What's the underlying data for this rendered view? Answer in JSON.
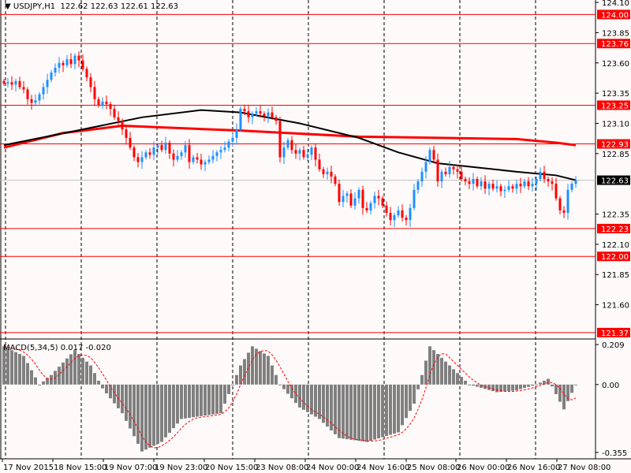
{
  "header": {
    "symbol": "USDJPY,H1",
    "ohlc": "122.62 122.63 122.61 122.63"
  },
  "colors": {
    "bull": "#1e90ff",
    "bear": "#ff0000",
    "level": "#ff0000",
    "ma_fast": "#ff0000",
    "ma_slow": "#000000",
    "hist": "#808080",
    "signal": "#ff0000",
    "bg": "#fffafa"
  },
  "chart_data": {
    "type": "candlestick",
    "title": "USDJPY,H1",
    "ylim": [
      121.33,
      124.12
    ],
    "price_ticks": [
      "124.10",
      "123.85",
      "123.60",
      "123.35",
      "123.10",
      "122.85",
      "122.35",
      "122.10",
      "121.85",
      "121.60"
    ],
    "levels": [
      "124.00",
      "123.76",
      "123.25",
      "122.93",
      "122.23",
      "122.00",
      "121.37"
    ],
    "current_price": "122.63",
    "x_labels": [
      "17 Nov 2015",
      "18 Nov 15:00",
      "19 Nov 07:00",
      "19 Nov 23:00",
      "20 Nov 15:00",
      "23 Nov 08:00",
      "24 Nov 00:00",
      "24 Nov 16:00",
      "25 Nov 08:00",
      "26 Nov 00:00",
      "26 Nov 16:00",
      "27 Nov 08:00"
    ],
    "closes": [
      123.43,
      123.44,
      123.42,
      123.45,
      123.4,
      123.38,
      123.3,
      123.27,
      123.29,
      123.34,
      123.4,
      123.46,
      123.52,
      123.56,
      123.6,
      123.58,
      123.63,
      123.59,
      123.66,
      123.62,
      123.55,
      123.48,
      123.4,
      123.3,
      123.25,
      123.28,
      123.26,
      123.22,
      123.15,
      123.12,
      123.05,
      122.98,
      122.9,
      122.82,
      122.78,
      122.82,
      122.86,
      122.84,
      122.9,
      122.92,
      122.88,
      122.94,
      122.85,
      122.8,
      122.83,
      122.86,
      122.92,
      122.78,
      122.82,
      122.8,
      122.76,
      122.78,
      122.8,
      122.83,
      122.86,
      122.88,
      122.9,
      122.95,
      122.98,
      123.05,
      123.22,
      123.2,
      123.15,
      123.18,
      123.2,
      123.18,
      123.16,
      123.19,
      123.15,
      123.12,
      122.82,
      122.9,
      122.96,
      122.88,
      122.85,
      122.88,
      122.82,
      122.84,
      122.9,
      122.8,
      122.72,
      122.68,
      122.7,
      122.66,
      122.6,
      122.45,
      122.5,
      122.52,
      122.42,
      122.48,
      122.55,
      122.4,
      122.38,
      122.44,
      122.5,
      122.48,
      122.42,
      122.36,
      122.3,
      122.34,
      122.38,
      122.32,
      122.3,
      122.4,
      122.55,
      122.62,
      122.7,
      122.78,
      122.88,
      122.8,
      122.62,
      122.7,
      122.68,
      122.74,
      122.72,
      122.7,
      122.64,
      122.62,
      122.6,
      122.64,
      122.58,
      122.62,
      122.56,
      122.6,
      122.56,
      122.58,
      122.54,
      122.55,
      122.58,
      122.56,
      122.6,
      122.58,
      122.62,
      122.58,
      122.6,
      122.64,
      122.7,
      122.64,
      122.62,
      122.6,
      122.48,
      122.38,
      122.36,
      122.55,
      122.6,
      122.63
    ],
    "ma_fast": [
      [
        0,
        122.9
      ],
      [
        15,
        123.02
      ],
      [
        30,
        123.08
      ],
      [
        60,
        123.04
      ],
      [
        90,
        122.99
      ],
      [
        130,
        122.97
      ],
      [
        140,
        122.94
      ],
      [
        145,
        122.92
      ]
    ],
    "ma_slow": [
      [
        0,
        122.92
      ],
      [
        20,
        123.05
      ],
      [
        35,
        123.15
      ],
      [
        50,
        123.21
      ],
      [
        60,
        123.19
      ],
      [
        75,
        123.1
      ],
      [
        90,
        122.98
      ],
      [
        100,
        122.86
      ],
      [
        110,
        122.77
      ],
      [
        130,
        122.7
      ],
      [
        140,
        122.67
      ],
      [
        145,
        122.63
      ]
    ],
    "macd": {
      "label": "MACD(5,34,5) 0.017 -0.020",
      "ticks": [
        "0.209",
        "0.00",
        "-0.355"
      ],
      "ylim": [
        -0.38,
        0.23
      ],
      "hist_keys": [
        [
          0,
          0.2
        ],
        [
          5,
          0.15
        ],
        [
          9,
          0.0
        ],
        [
          12,
          0.05
        ],
        [
          18,
          0.18
        ],
        [
          22,
          0.1
        ],
        [
          25,
          -0.02
        ],
        [
          30,
          -0.15
        ],
        [
          35,
          -0.35
        ],
        [
          40,
          -0.3
        ],
        [
          45,
          -0.18
        ],
        [
          55,
          -0.15
        ],
        [
          60,
          0.1
        ],
        [
          63,
          0.2
        ],
        [
          67,
          0.15
        ],
        [
          70,
          0.0
        ],
        [
          75,
          -0.12
        ],
        [
          80,
          -0.18
        ],
        [
          85,
          -0.28
        ],
        [
          92,
          -0.3
        ],
        [
          100,
          -0.25
        ],
        [
          104,
          -0.1
        ],
        [
          108,
          0.2
        ],
        [
          112,
          0.12
        ],
        [
          118,
          0.0
        ],
        [
          125,
          -0.04
        ],
        [
          130,
          -0.03
        ],
        [
          135,
          0.0
        ],
        [
          138,
          0.03
        ],
        [
          142,
          -0.13
        ],
        [
          145,
          0.0
        ]
      ]
    }
  }
}
